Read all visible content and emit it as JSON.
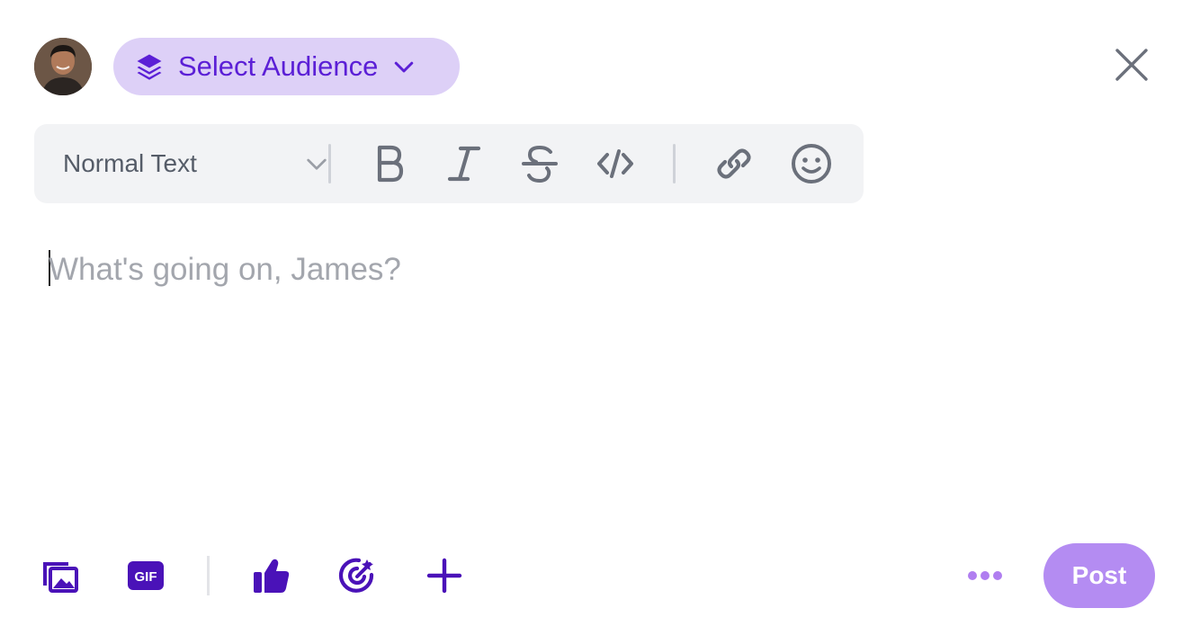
{
  "composer": {
    "avatar_alt": "James",
    "audience_label": "Select Audience",
    "close_label": "Close",
    "placeholder": "What's going on, James?"
  },
  "toolbar": {
    "format_value": "Normal Text",
    "buttons": [
      {
        "name": "bold",
        "icon": "bold-icon"
      },
      {
        "name": "italic",
        "icon": "italic-icon"
      },
      {
        "name": "strikethrough",
        "icon": "strikethrough-icon"
      },
      {
        "name": "code",
        "icon": "code-icon"
      },
      {
        "name": "link",
        "icon": "link-icon"
      },
      {
        "name": "emoji",
        "icon": "smiley-icon"
      }
    ]
  },
  "attachments": [
    {
      "name": "media",
      "icon": "images-icon"
    },
    {
      "name": "gif",
      "icon": "gif-icon",
      "label": "GIF"
    },
    {
      "name": "reaction",
      "icon": "thumbs-up-icon"
    },
    {
      "name": "goal",
      "icon": "target-icon"
    },
    {
      "name": "add",
      "icon": "plus-icon"
    }
  ],
  "actions": {
    "more_icon": "ellipsis-icon",
    "post_label": "Post"
  },
  "colors": {
    "accent": "#5b1fd6",
    "accent_icon": "#4a12b8",
    "audience_bg": "#ddd0f7",
    "post_bg": "#b48cf2",
    "toolbar_bg": "#f2f3f5",
    "toolbar_icon": "#6b707b",
    "placeholder": "#a3a6ad"
  }
}
